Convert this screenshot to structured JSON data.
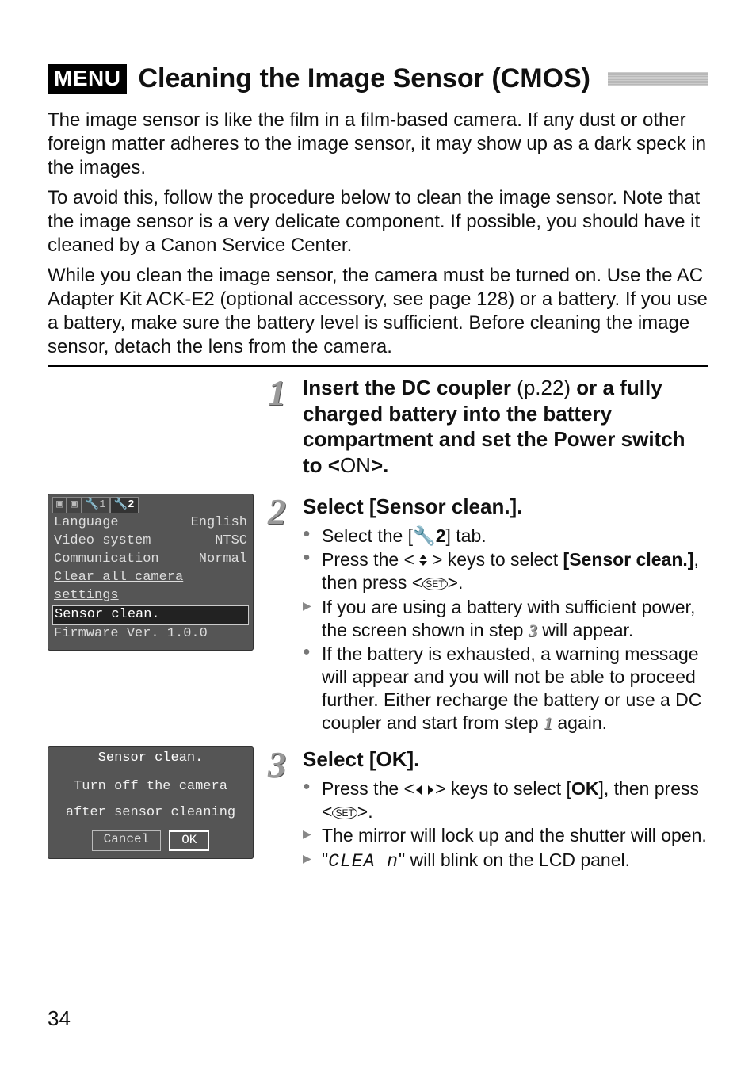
{
  "header": {
    "badge": "MENU",
    "title": "Cleaning the Image Sensor (CMOS)"
  },
  "intro": {
    "p1": "The image sensor is like the film in a film-based camera. If any dust or other foreign matter adheres to the image sensor, it may show up as a dark speck in the images.",
    "p2": "To avoid this, follow the procedure below to clean the image sensor. Note that the image sensor is a very delicate component. If possible, you should have it cleaned by a Canon Service Center.",
    "p3": "While you clean the image sensor, the camera must be turned on. Use the AC Adapter Kit ACK-E2 (optional accessory, see page 128) or a battery. If you use a battery, make sure the battery level is sufficient. Before cleaning the image sensor, detach the lens from the camera."
  },
  "steps": {
    "s1": {
      "num": "1",
      "heading_a": "Insert the DC coupler ",
      "heading_ref": "(p.22)",
      "heading_b": " or a fully charged battery into the battery compartment and set the Power switch to <",
      "heading_on": "ON",
      "heading_c": ">."
    },
    "s2": {
      "num": "2",
      "heading": "Select [Sensor clean.].",
      "b1_a": "Select the [",
      "b1_tab": "🔧2",
      "b1_b": "] tab.",
      "b2_a": "Press the <",
      "b2_b": "> keys to select ",
      "b2_item": "[Sensor clean.]",
      "b2_c": ", then press <",
      "b2_d": ">.",
      "b3_a": "If you are using a battery with sufficient power, the screen shown in step ",
      "b3_step": "3",
      "b3_b": " will appear.",
      "b4_a": "If the battery is exhausted, a warning message will appear and you will not be able to proceed further. Either recharge the battery or use a DC coupler and start from step ",
      "b4_step": "1",
      "b4_b": " again."
    },
    "s3": {
      "num": "3",
      "heading": "Select [OK].",
      "b1_a": "Press the <",
      "b1_b": "> keys to select [",
      "b1_ok": "OK",
      "b1_c": "], then press <",
      "b1_d": ">.",
      "b2": "The mirror will lock up and the shutter will open.",
      "b3_a": "\"",
      "b3_code": "CLEA n",
      "b3_b": "\" will blink on the LCD panel."
    }
  },
  "lcd1": {
    "tabs": [
      "▣",
      "▣",
      "🔧1",
      "🔧2"
    ],
    "active_tab": "🔧2",
    "rows": [
      {
        "label": "Language",
        "value": "English"
      },
      {
        "label": "Video system",
        "value": "NTSC"
      },
      {
        "label": "Communication",
        "value": "Normal"
      },
      {
        "label": "Clear all camera settings",
        "value": ""
      },
      {
        "label": "Sensor clean.",
        "value": ""
      },
      {
        "label": "Firmware Ver. 1.0.0",
        "value": ""
      }
    ],
    "highlight_index": 4
  },
  "lcd2": {
    "title": "Sensor clean.",
    "msg1": "Turn off the camera",
    "msg2": "after sensor cleaning",
    "buttons": [
      "Cancel",
      "OK"
    ],
    "selected_index": 1
  },
  "set_label": "SET",
  "page_number": "34"
}
